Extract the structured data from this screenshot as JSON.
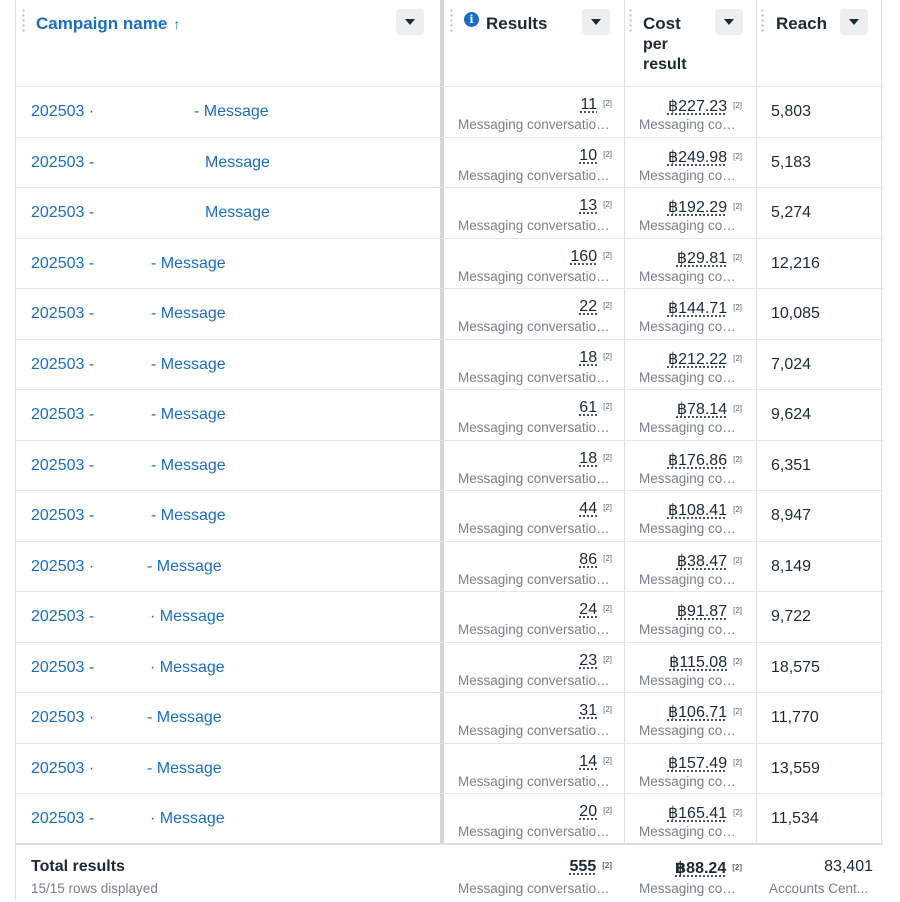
{
  "header": {
    "campaign_name": "Campaign name",
    "sort_arrow": "↑",
    "results": "Results",
    "info_glyph": "i",
    "cost_line1": "Cost",
    "cost_line2": "per",
    "cost_line3": "result",
    "reach": "Reach"
  },
  "rows": [
    {
      "prefix": "202503 ·",
      "suffix": "- Message",
      "result": "11",
      "result_note": "[2]",
      "result_sub": "Messaging conversations started",
      "cost": "฿227.23",
      "cost_note": "[2]",
      "cost_sub": "Messaging conversations started",
      "reach": "5,803"
    },
    {
      "prefix": "202503 -",
      "suffix": "Message",
      "result": "10",
      "result_note": "[2]",
      "result_sub": "Messaging conversations started",
      "cost": "฿249.98",
      "cost_note": "[2]",
      "cost_sub": "Messaging conversations started",
      "reach": "5,183"
    },
    {
      "prefix": "202503 -",
      "suffix": "Message",
      "result": "13",
      "result_note": "[2]",
      "result_sub": "Messaging conversations started",
      "cost": "฿192.29",
      "cost_note": "[2]",
      "cost_sub": "Messaging conversations started",
      "reach": "5,274"
    },
    {
      "prefix": "202503 -",
      "suffix": "- Message",
      "result": "160",
      "result_note": "[2]",
      "result_sub": "Messaging conversations started",
      "cost": "฿29.81",
      "cost_note": "[2]",
      "cost_sub": "Messaging conversations started",
      "reach": "12,216"
    },
    {
      "prefix": "202503 -",
      "suffix": "- Message",
      "result": "22",
      "result_note": "[2]",
      "result_sub": "Messaging conversations started",
      "cost": "฿144.71",
      "cost_note": "[2]",
      "cost_sub": "Messaging conversations started",
      "reach": "10,085"
    },
    {
      "prefix": "202503 -",
      "suffix": "- Message",
      "result": "18",
      "result_note": "[2]",
      "result_sub": "Messaging conversations started",
      "cost": "฿212.22",
      "cost_note": "[2]",
      "cost_sub": "Messaging conversations started",
      "reach": "7,024"
    },
    {
      "prefix": "202503 -",
      "suffix": "- Message",
      "result": "61",
      "result_note": "[2]",
      "result_sub": "Messaging conversations started",
      "cost": "฿78.14",
      "cost_note": "[2]",
      "cost_sub": "Messaging conversations started",
      "reach": "9,624"
    },
    {
      "prefix": "202503 -",
      "suffix": "- Message",
      "result": "18",
      "result_note": "[2]",
      "result_sub": "Messaging conversations started",
      "cost": "฿176.86",
      "cost_note": "[2]",
      "cost_sub": "Messaging conversations started",
      "reach": "6,351"
    },
    {
      "prefix": "202503 -",
      "suffix": "- Message",
      "result": "44",
      "result_note": "[2]",
      "result_sub": "Messaging conversations started",
      "cost": "฿108.41",
      "cost_note": "[2]",
      "cost_sub": "Messaging conversations started",
      "reach": "8,947"
    },
    {
      "prefix": "202503 ·",
      "suffix": "- Message",
      "result": "86",
      "result_note": "[2]",
      "result_sub": "Messaging conversations started",
      "cost": "฿38.47",
      "cost_note": "[2]",
      "cost_sub": "Messaging conversations started",
      "reach": "8,149"
    },
    {
      "prefix": "202503 -",
      "suffix": "· Message",
      "result": "24",
      "result_note": "[2]",
      "result_sub": "Messaging conversations started",
      "cost": "฿91.87",
      "cost_note": "[2]",
      "cost_sub": "Messaging conversations started",
      "reach": "9,722"
    },
    {
      "prefix": "202503 -",
      "suffix": "· Message",
      "result": "23",
      "result_note": "[2]",
      "result_sub": "Messaging conversations started",
      "cost": "฿115.08",
      "cost_note": "[2]",
      "cost_sub": "Messaging conversations started",
      "reach": "18,575"
    },
    {
      "prefix": "202503 ·",
      "suffix": "- Message",
      "result": "31",
      "result_note": "[2]",
      "result_sub": "Messaging conversations started",
      "cost": "฿106.71",
      "cost_note": "[2]",
      "cost_sub": "Messaging conversations started",
      "reach": "11,770"
    },
    {
      "prefix": "202503 ·",
      "suffix": "- Message",
      "result": "14",
      "result_note": "[2]",
      "result_sub": "Messaging conversations started",
      "cost": "฿157.49",
      "cost_note": "[2]",
      "cost_sub": "Messaging conversations started",
      "reach": "13,559"
    },
    {
      "prefix": "202503 -",
      "suffix": "· Message",
      "result": "20",
      "result_note": "[2]",
      "result_sub": "Messaging conversations started",
      "cost": "฿165.41",
      "cost_note": "[2]",
      "cost_sub": "Messaging conversations started",
      "reach": "11,534"
    }
  ],
  "total": {
    "title": "Total results",
    "rows_displayed": "15/15 rows displayed",
    "results": "555",
    "results_note": "[2]",
    "results_sub": "Messaging conversations started",
    "cost": "฿88.24",
    "cost_note": "[2]",
    "cost_sub": "Messaging conversations started",
    "reach": "83,401",
    "reach_sub": "Accounts Cent..."
  },
  "colors": {
    "link": "#1a6ec2",
    "text": "#1c2b33",
    "muted": "#7a8088",
    "dropdown_bg": "#eceef0",
    "border": "#e4e6eb"
  },
  "icons": {
    "sort": "arrow-up-icon",
    "dropdown": "caret-down-icon",
    "info": "info-icon",
    "grip": "column-drag-handle-icon"
  }
}
